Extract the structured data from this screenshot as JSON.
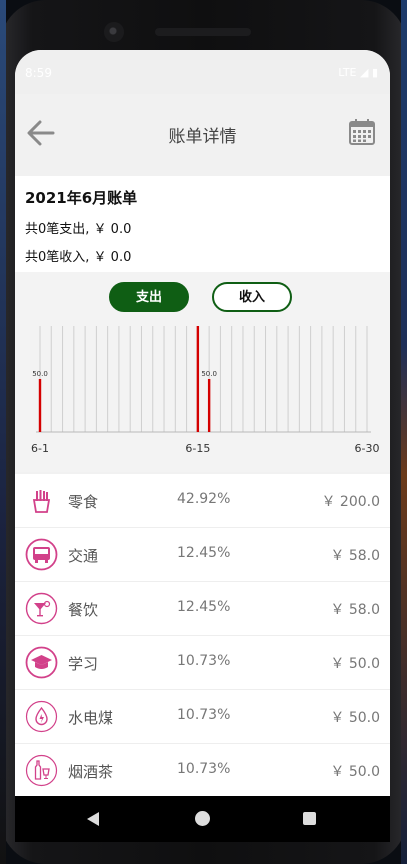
{
  "status": {
    "time": "8:59",
    "icons": "LTE ◢ ▮"
  },
  "header": {
    "title": "账单详情"
  },
  "summary": {
    "title": "2021年6月账单",
    "expense_line": "共0笔支出, ￥ 0.0",
    "income_line": "共0笔收入, ￥ 0.0"
  },
  "toggle": {
    "expense_label": "支出",
    "income_label": "收入"
  },
  "chart_data": {
    "type": "bar",
    "days": 30,
    "bars": [
      {
        "day": 1,
        "value": 50.0,
        "label": "50.0"
      },
      {
        "day": 15,
        "value": 100.0,
        "label": ""
      },
      {
        "day": 16,
        "value": 50.0,
        "label": "50.0"
      }
    ],
    "xticks": [
      {
        "day": 1,
        "label": "6-1"
      },
      {
        "day": 15,
        "label": "6-15"
      },
      {
        "day": 30,
        "label": "6-30"
      }
    ],
    "ylim": [
      0,
      100
    ],
    "grid": true,
    "bar_color": "#d40000"
  },
  "categories": [
    {
      "name": "零食",
      "percent": "42.92%",
      "amount": "￥ 200.0",
      "icon": "fries-icon"
    },
    {
      "name": "交通",
      "percent": "12.45%",
      "amount": "￥ 58.0",
      "icon": "bus-icon"
    },
    {
      "name": "餐饮",
      "percent": "12.45%",
      "amount": "￥ 58.0",
      "icon": "cocktail-icon"
    },
    {
      "name": "学习",
      "percent": "10.73%",
      "amount": "￥ 50.0",
      "icon": "graduation-cap-icon"
    },
    {
      "name": "水电煤",
      "percent": "10.73%",
      "amount": "￥ 50.0",
      "icon": "drop-flame-icon"
    },
    {
      "name": "烟酒茶",
      "percent": "10.73%",
      "amount": "￥ 50.0",
      "icon": "bottle-glass-icon"
    }
  ],
  "colors": {
    "accent": "#0f5e14",
    "icon": "#d2418a",
    "bar": "#d40000"
  }
}
